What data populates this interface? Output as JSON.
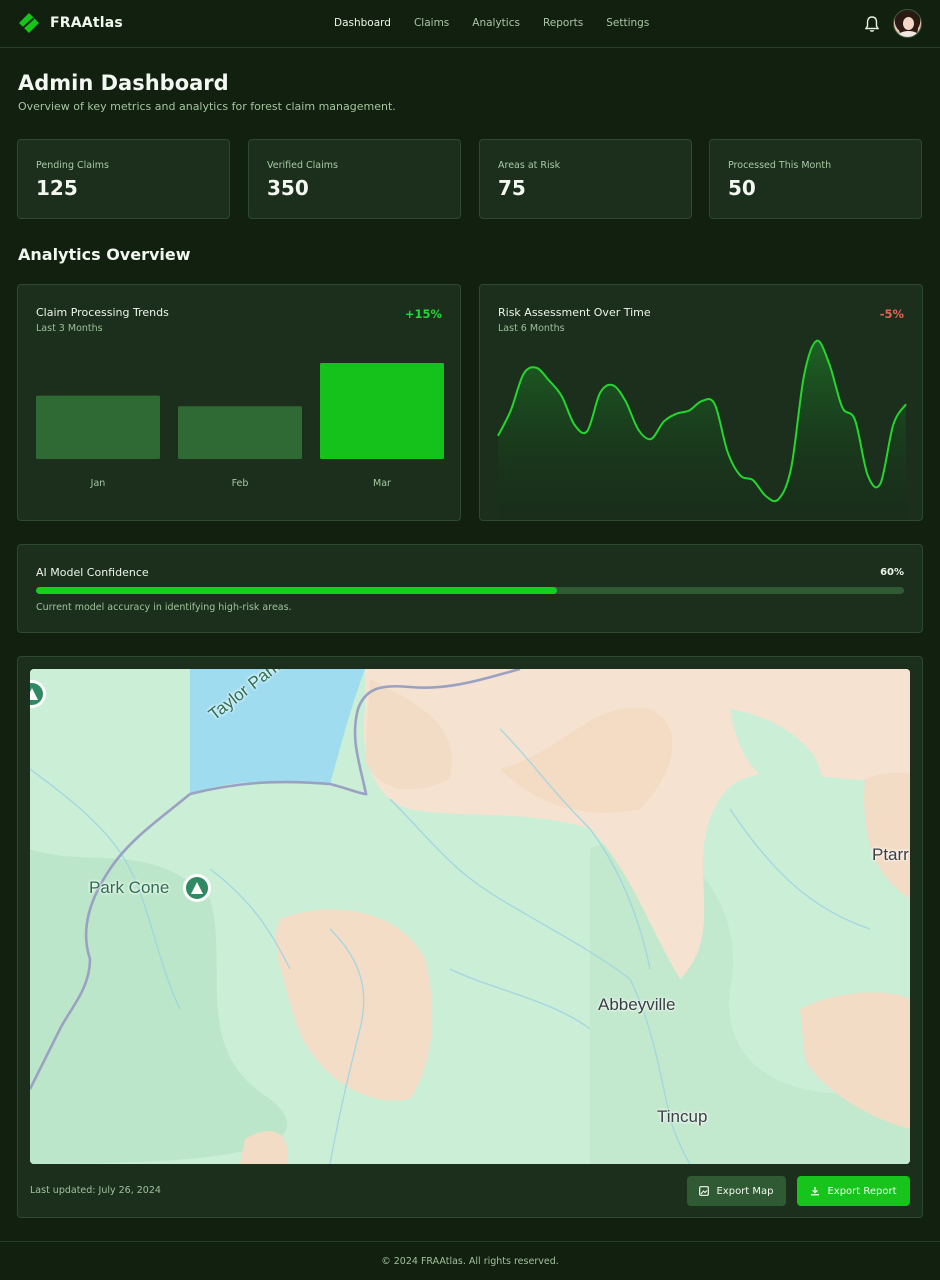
{
  "header": {
    "brand": "FRAAtlas",
    "nav": [
      "Dashboard",
      "Claims",
      "Analytics",
      "Reports",
      "Settings"
    ],
    "active_nav": "Dashboard",
    "icons": [
      "leaf-logo-icon",
      "bell-icon",
      "user-avatar"
    ]
  },
  "page": {
    "title": "Admin Dashboard",
    "subtitle": "Overview of key metrics and analytics for forest claim management."
  },
  "stats": [
    {
      "label": "Pending Claims",
      "value": "125"
    },
    {
      "label": "Verified Claims",
      "value": "350"
    },
    {
      "label": "Areas at Risk",
      "value": "75"
    },
    {
      "label": "Processed This Month",
      "value": "50"
    }
  ],
  "analytics": {
    "section_title": "Analytics Overview",
    "claims": {
      "title": "Claim Processing Trends",
      "subtitle": "Last 3 Months",
      "delta": "+15%"
    },
    "risk": {
      "title": "Risk Assessment Over Time",
      "subtitle": "Last 6 Months",
      "delta": "-5%"
    }
  },
  "chart_data": [
    {
      "type": "bar",
      "categories": [
        "Jan",
        "Feb",
        "Mar"
      ],
      "values": [
        66,
        55,
        100
      ],
      "highlight_index": 2,
      "colors": {
        "bar": "#2f6a34",
        "highlight": "#14c21b"
      }
    },
    {
      "type": "area",
      "x": [
        0,
        1,
        2,
        3,
        4,
        5,
        6,
        7,
        8,
        9,
        10,
        11,
        12,
        13,
        14,
        15,
        16,
        17,
        18,
        19,
        20,
        21,
        22,
        23,
        24,
        25,
        26,
        27,
        28,
        29,
        30,
        31,
        32,
        33,
        34,
        35,
        36,
        37,
        38,
        39,
        40
      ],
      "values": [
        50,
        66,
        89,
        93,
        85,
        75,
        57,
        53,
        77,
        82,
        72,
        54,
        48,
        59,
        64,
        66,
        72,
        70,
        40,
        25,
        22,
        12,
        10,
        30,
        88,
        110,
        95,
        68,
        60,
        25,
        20,
        57,
        70
      ],
      "y_range": [
        0,
        120
      ],
      "colors": {
        "line": "#24d62f",
        "fill_top": "#1e6a25",
        "fill_bottom": "#142a16"
      }
    }
  ],
  "confidence": {
    "title": "AI Model Confidence",
    "percent_label": "60%",
    "percent": 60,
    "description": "Current model accuracy in identifying high-risk areas."
  },
  "map": {
    "labels": [
      "Taylor Park Reser",
      "Park Cone",
      "Abbeyville",
      "Tincup",
      "Ptarr"
    ],
    "last_updated": "Last updated: July 26, 2024",
    "buttons": {
      "export_map": "Export Map",
      "export_report": "Export Report"
    }
  },
  "footer": {
    "text": "© 2024 FRAAtlas. All rights reserved."
  },
  "colors": {
    "accent": "#14c21b",
    "background": "#11200f",
    "card": "#1b2f1c"
  }
}
